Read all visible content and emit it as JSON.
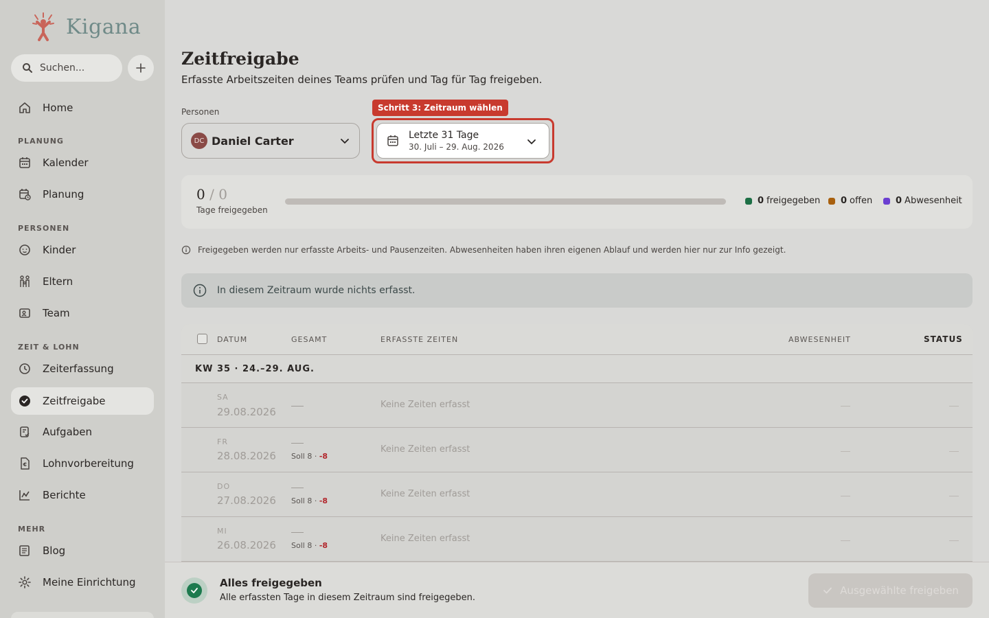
{
  "app": {
    "name": "Kigana"
  },
  "search": {
    "placeholder": "Suchen..."
  },
  "sidebar": {
    "home": "Home",
    "sections": {
      "planung": "PLANUNG",
      "personen": "PERSONEN",
      "zeit_lohn": "ZEIT & LOHN",
      "mehr": "MEHR"
    },
    "items": {
      "kalender": "Kalender",
      "planung": "Planung",
      "kinder": "Kinder",
      "eltern": "Eltern",
      "team": "Team",
      "zeiterfassung": "Zeiterfassung",
      "zeitfreigabe": "Zeitfreigabe",
      "aufgaben": "Aufgaben",
      "lohnvorbereitung": "Lohnvorbereitung",
      "berichte": "Berichte",
      "blog": "Blog",
      "einrichtung": "Meine Einrichtung"
    },
    "active": "zeitfreigabe"
  },
  "page": {
    "title": "Zeitfreigabe",
    "subtitle": "Erfasste Arbeitszeiten deines Teams prüfen und Tag für Tag freigeben."
  },
  "filters": {
    "persons_label": "Personen",
    "person": {
      "initials": "DC",
      "name": "Daniel Carter"
    },
    "step_badge": "Schritt 3: Zeitraum wählen",
    "range": {
      "label": "Letzte 31 Tage",
      "dates": "30. Juli – 29. Aug. 2026"
    }
  },
  "progress": {
    "approved": "0",
    "separator": "/",
    "total": "0",
    "label": "Tage freigegeben",
    "fraction": 0,
    "legend": {
      "freigegeben": {
        "count": "0",
        "label": "freigegeben",
        "color": "#1d6f45"
      },
      "offen": {
        "count": "0",
        "label": "offen",
        "color": "#a8600e"
      },
      "abwesenheit": {
        "count": "0",
        "label": "Abwesenheit",
        "color": "#6b3fd1"
      }
    }
  },
  "info": "Freigegeben werden nur erfasste Arbeits- und Pausenzeiten. Abwesenheiten haben ihren eigenen Ablauf und werden hier nur zur Info gezeigt.",
  "empty_alert": "In diesem Zeitraum wurde nichts erfasst.",
  "table": {
    "headers": {
      "datum": "DATUM",
      "gesamt": "GESAMT",
      "erfasste": "ERFASSTE ZEITEN",
      "abwesenheit": "ABWESENHEIT",
      "status": "STATUS"
    },
    "week": "KW 35 · 24.–29. AUG.",
    "rows": [
      {
        "weekday": "SA",
        "date": "29.08.2026",
        "soll": "",
        "diff": "",
        "entries": "Keine Zeiten erfasst"
      },
      {
        "weekday": "FR",
        "date": "28.08.2026",
        "soll": "Soll 8 · ",
        "diff": "-8",
        "entries": "Keine Zeiten erfasst"
      },
      {
        "weekday": "DO",
        "date": "27.08.2026",
        "soll": "Soll 8 · ",
        "diff": "-8",
        "entries": "Keine Zeiten erfasst"
      },
      {
        "weekday": "MI",
        "date": "26.08.2026",
        "soll": "Soll 8 · ",
        "diff": "-8",
        "entries": "Keine Zeiten erfasst"
      }
    ]
  },
  "footer": {
    "title": "Alles freigegeben",
    "desc": "Alle erfassten Tage in diesem Zeitraum sind freigegeben.",
    "button": "Ausgewählte freigeben"
  },
  "colors": {
    "accent": "#c83a2e",
    "success": "#1d7a4e",
    "negative": "#b2262c"
  }
}
